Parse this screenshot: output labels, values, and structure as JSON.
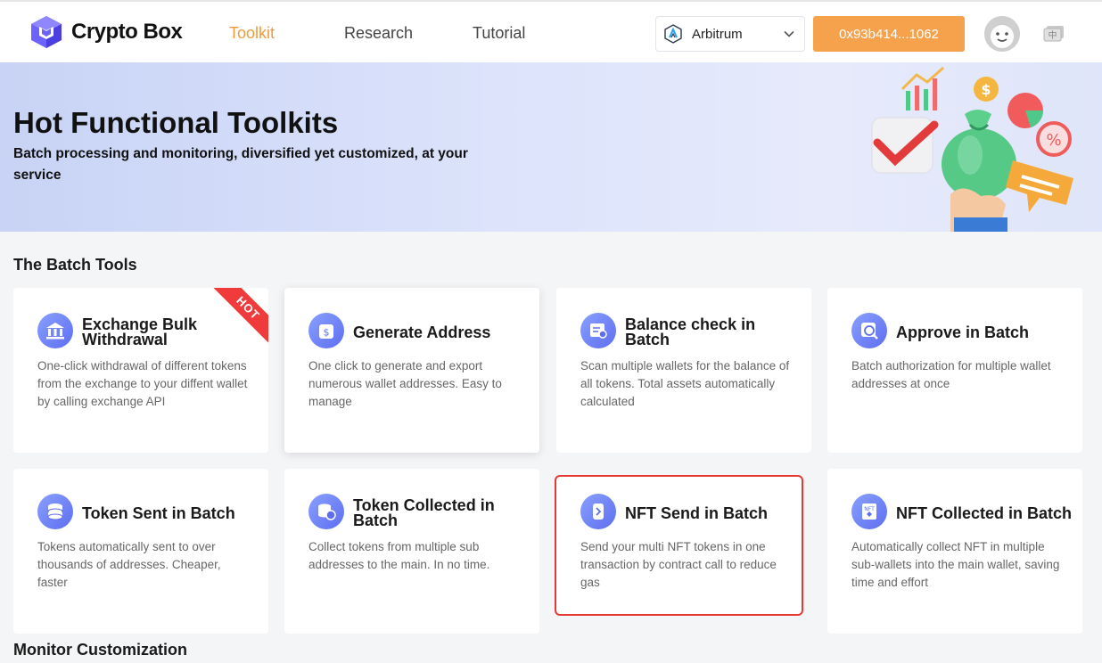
{
  "header": {
    "logo_text": "Crypto Box",
    "nav": [
      "Toolkit",
      "Research",
      "Tutorial"
    ],
    "network": "Arbitrum",
    "wallet": "0x93b414...1062",
    "lang_label": "中"
  },
  "banner": {
    "title": "Hot Functional Toolkits",
    "subtitle": "Batch processing and monitoring, diversified yet customized, at your service"
  },
  "batch_title": "The Batch Tools",
  "monitor_title": "Monitor Customization",
  "hot_label": "HOT",
  "cards": [
    {
      "title": "Exchange Bulk Withdrawal",
      "desc": "One-click withdrawal of different tokens from the exchange to your diffent wallet by calling exchange API",
      "icon": "exchange-icon"
    },
    {
      "title": "Generate Address",
      "desc": "One click to generate and export numerous wallet addresses. Easy to manage",
      "icon": "wallet-icon"
    },
    {
      "title": "Balance check in Batch",
      "desc": "Scan multiple wallets for the balance of all tokens. Total assets automatically calculated",
      "icon": "balance-check-icon"
    },
    {
      "title": "Approve in Batch",
      "desc": "Batch authorization for multiple wallet addresses at once",
      "icon": "approve-icon"
    },
    {
      "title": "Token Sent in Batch",
      "desc": "Tokens automatically sent to over thousands of addresses. Cheaper, faster",
      "icon": "coins-icon"
    },
    {
      "title": "Token Collected in Batch",
      "desc": "Collect tokens from multiple sub addresses to the main. In no time.",
      "icon": "collect-icon"
    },
    {
      "title": "NFT Send in Batch",
      "desc": "Send your multi NFT tokens in one transaction by contract call to reduce gas",
      "icon": "nft-send-icon"
    },
    {
      "title": "NFT Collected in Batch",
      "desc": "Automatically collect NFT in multiple sub-wallets into the main wallet, saving time and effort",
      "icon": "nft-collect-icon"
    }
  ]
}
